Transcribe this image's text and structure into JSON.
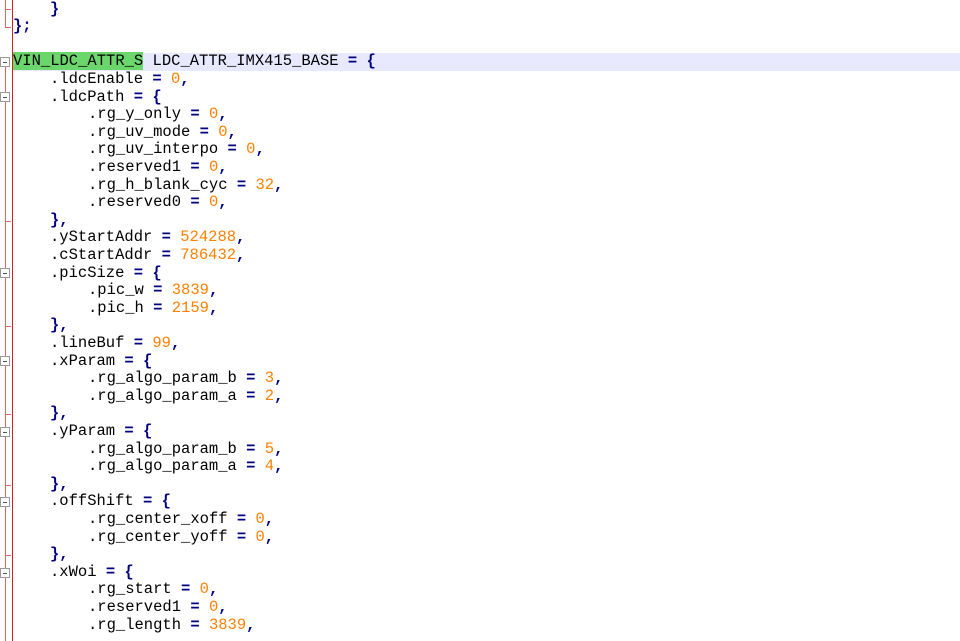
{
  "editor": {
    "lines": [
      {
        "indent": 1,
        "parts": [
          {
            "t": "}",
            "c": "kw"
          }
        ]
      },
      {
        "indent": 0,
        "parts": [
          {
            "t": "};",
            "c": "kw"
          }
        ]
      },
      {
        "indent": 0,
        "parts": []
      },
      {
        "indent": 0,
        "current": true,
        "parts": [
          {
            "t": "VIN_LDC_ATTR_S",
            "c": "hl"
          },
          {
            "t": " LDC_ATTR_IMX415_BASE "
          },
          {
            "t": "= {",
            "c": "kw"
          }
        ]
      },
      {
        "indent": 1,
        "parts": [
          {
            "t": ".ldcEnable "
          },
          {
            "t": "= ",
            "c": "kw"
          },
          {
            "t": "0",
            "c": "num"
          },
          {
            "t": ",",
            "c": "kw"
          }
        ]
      },
      {
        "indent": 1,
        "parts": [
          {
            "t": ".ldcPath "
          },
          {
            "t": "= {",
            "c": "kw"
          }
        ]
      },
      {
        "indent": 2,
        "parts": [
          {
            "t": ".rg_y_only "
          },
          {
            "t": "= ",
            "c": "kw"
          },
          {
            "t": "0",
            "c": "num"
          },
          {
            "t": ",",
            "c": "kw"
          }
        ]
      },
      {
        "indent": 2,
        "parts": [
          {
            "t": ".rg_uv_mode "
          },
          {
            "t": "= ",
            "c": "kw"
          },
          {
            "t": "0",
            "c": "num"
          },
          {
            "t": ",",
            "c": "kw"
          }
        ]
      },
      {
        "indent": 2,
        "parts": [
          {
            "t": ".rg_uv_interpo "
          },
          {
            "t": "= ",
            "c": "kw"
          },
          {
            "t": "0",
            "c": "num"
          },
          {
            "t": ",",
            "c": "kw"
          }
        ]
      },
      {
        "indent": 2,
        "parts": [
          {
            "t": ".reserved1 "
          },
          {
            "t": "= ",
            "c": "kw"
          },
          {
            "t": "0",
            "c": "num"
          },
          {
            "t": ",",
            "c": "kw"
          }
        ]
      },
      {
        "indent": 2,
        "parts": [
          {
            "t": ".rg_h_blank_cyc "
          },
          {
            "t": "= ",
            "c": "kw"
          },
          {
            "t": "32",
            "c": "num"
          },
          {
            "t": ",",
            "c": "kw"
          }
        ]
      },
      {
        "indent": 2,
        "parts": [
          {
            "t": ".reserved0 "
          },
          {
            "t": "= ",
            "c": "kw"
          },
          {
            "t": "0",
            "c": "num"
          },
          {
            "t": ",",
            "c": "kw"
          }
        ]
      },
      {
        "indent": 1,
        "parts": [
          {
            "t": "},",
            "c": "kw"
          }
        ]
      },
      {
        "indent": 1,
        "parts": [
          {
            "t": ".yStartAddr "
          },
          {
            "t": "= ",
            "c": "kw"
          },
          {
            "t": "524288",
            "c": "num"
          },
          {
            "t": ",",
            "c": "kw"
          }
        ]
      },
      {
        "indent": 1,
        "parts": [
          {
            "t": ".cStartAddr "
          },
          {
            "t": "= ",
            "c": "kw"
          },
          {
            "t": "786432",
            "c": "num"
          },
          {
            "t": ",",
            "c": "kw"
          }
        ]
      },
      {
        "indent": 1,
        "parts": [
          {
            "t": ".picSize "
          },
          {
            "t": "= {",
            "c": "kw"
          }
        ]
      },
      {
        "indent": 2,
        "parts": [
          {
            "t": ".pic_w "
          },
          {
            "t": "= ",
            "c": "kw"
          },
          {
            "t": "3839",
            "c": "num"
          },
          {
            "t": ",",
            "c": "kw"
          }
        ]
      },
      {
        "indent": 2,
        "parts": [
          {
            "t": ".pic_h "
          },
          {
            "t": "= ",
            "c": "kw"
          },
          {
            "t": "2159",
            "c": "num"
          },
          {
            "t": ",",
            "c": "kw"
          }
        ]
      },
      {
        "indent": 1,
        "parts": [
          {
            "t": "},",
            "c": "kw"
          }
        ]
      },
      {
        "indent": 1,
        "parts": [
          {
            "t": ".lineBuf "
          },
          {
            "t": "= ",
            "c": "kw"
          },
          {
            "t": "99",
            "c": "num"
          },
          {
            "t": ",",
            "c": "kw"
          }
        ]
      },
      {
        "indent": 1,
        "parts": [
          {
            "t": ".xParam "
          },
          {
            "t": "= {",
            "c": "kw"
          }
        ]
      },
      {
        "indent": 2,
        "parts": [
          {
            "t": ".rg_algo_param_b "
          },
          {
            "t": "= ",
            "c": "kw"
          },
          {
            "t": "3",
            "c": "num"
          },
          {
            "t": ",",
            "c": "kw"
          }
        ]
      },
      {
        "indent": 2,
        "parts": [
          {
            "t": ".rg_algo_param_a "
          },
          {
            "t": "= ",
            "c": "kw"
          },
          {
            "t": "2",
            "c": "num"
          },
          {
            "t": ",",
            "c": "kw"
          }
        ]
      },
      {
        "indent": 1,
        "parts": [
          {
            "t": "},",
            "c": "kw"
          }
        ]
      },
      {
        "indent": 1,
        "parts": [
          {
            "t": ".yParam "
          },
          {
            "t": "= {",
            "c": "kw"
          }
        ]
      },
      {
        "indent": 2,
        "parts": [
          {
            "t": ".rg_algo_param_b "
          },
          {
            "t": "= ",
            "c": "kw"
          },
          {
            "t": "5",
            "c": "num"
          },
          {
            "t": ",",
            "c": "kw"
          }
        ]
      },
      {
        "indent": 2,
        "parts": [
          {
            "t": ".rg_algo_param_a "
          },
          {
            "t": "= ",
            "c": "kw"
          },
          {
            "t": "4",
            "c": "num"
          },
          {
            "t": ",",
            "c": "kw"
          }
        ]
      },
      {
        "indent": 1,
        "parts": [
          {
            "t": "},",
            "c": "kw"
          }
        ]
      },
      {
        "indent": 1,
        "parts": [
          {
            "t": ".offShift "
          },
          {
            "t": "= {",
            "c": "kw"
          }
        ]
      },
      {
        "indent": 2,
        "parts": [
          {
            "t": ".rg_center_xoff "
          },
          {
            "t": "= ",
            "c": "kw"
          },
          {
            "t": "0",
            "c": "num"
          },
          {
            "t": ",",
            "c": "kw"
          }
        ]
      },
      {
        "indent": 2,
        "parts": [
          {
            "t": ".rg_center_yoff "
          },
          {
            "t": "= ",
            "c": "kw"
          },
          {
            "t": "0",
            "c": "num"
          },
          {
            "t": ",",
            "c": "kw"
          }
        ]
      },
      {
        "indent": 1,
        "parts": [
          {
            "t": "},",
            "c": "kw"
          }
        ]
      },
      {
        "indent": 1,
        "parts": [
          {
            "t": ".xWoi "
          },
          {
            "t": "= {",
            "c": "kw"
          }
        ]
      },
      {
        "indent": 2,
        "parts": [
          {
            "t": ".rg_start "
          },
          {
            "t": "= ",
            "c": "kw"
          },
          {
            "t": "0",
            "c": "num"
          },
          {
            "t": ",",
            "c": "kw"
          }
        ]
      },
      {
        "indent": 2,
        "parts": [
          {
            "t": ".reserved1 "
          },
          {
            "t": "= ",
            "c": "kw"
          },
          {
            "t": "0",
            "c": "num"
          },
          {
            "t": ",",
            "c": "kw"
          }
        ]
      },
      {
        "indent": 2,
        "parts": [
          {
            "t": ".rg_length "
          },
          {
            "t": "= ",
            "c": "kw"
          },
          {
            "t": "3839",
            "c": "num"
          },
          {
            "t": ",",
            "c": "kw"
          }
        ]
      }
    ]
  },
  "colors": {
    "keyword": "#000080",
    "number": "#ff8000",
    "highlight": "#6bd66b",
    "current_line": "#e8e8ff",
    "fold_line": "#e06666"
  }
}
